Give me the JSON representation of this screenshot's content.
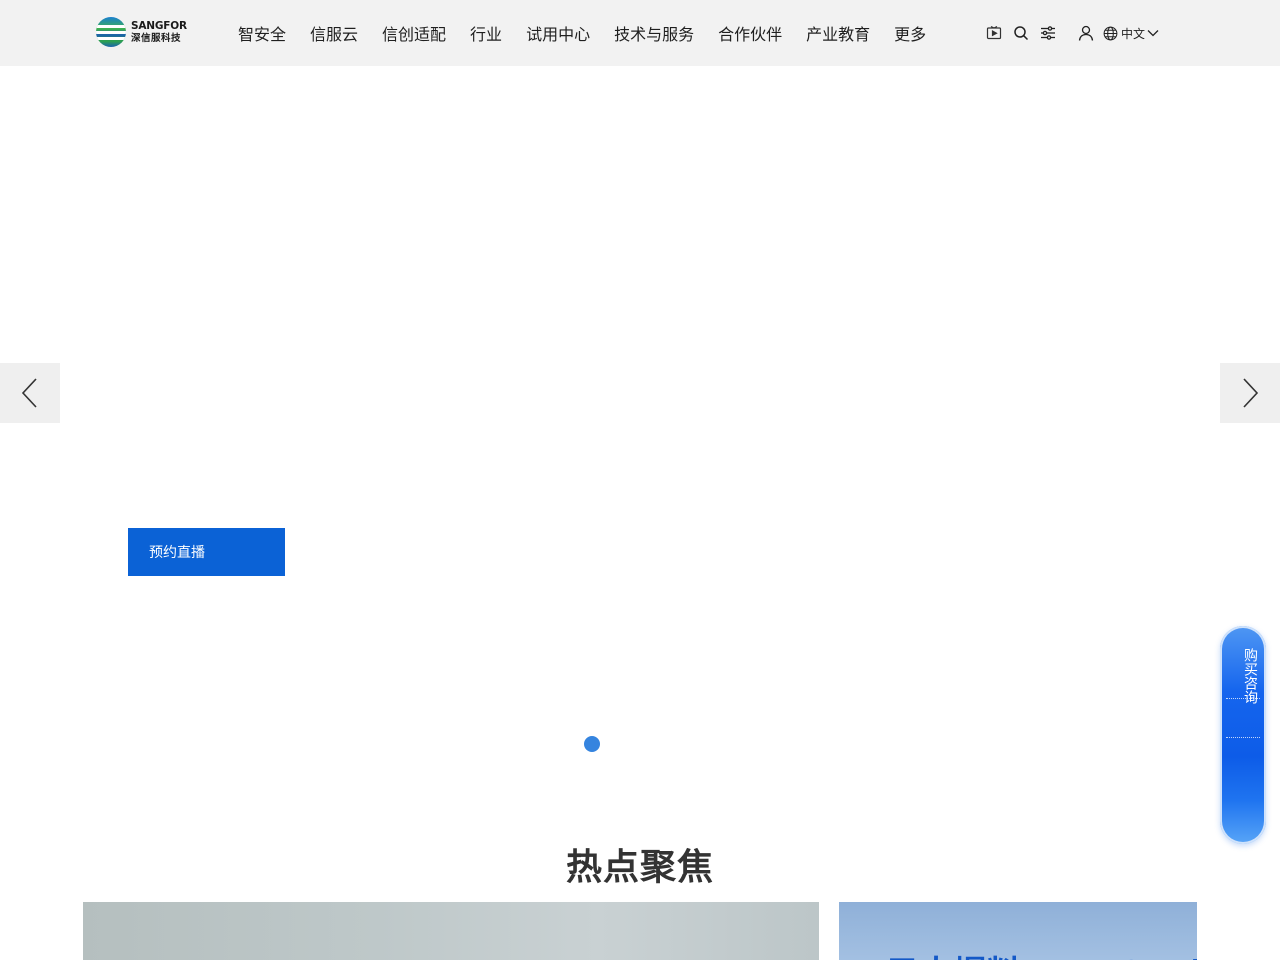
{
  "brand": {
    "logo_en": "SANGFOR",
    "logo_cn": "深信服科技",
    "logo_color_blue": "#1a7fd0",
    "logo_color_green": "#3fb24b"
  },
  "nav": {
    "items": [
      {
        "label": "智安全"
      },
      {
        "label": "信服云"
      },
      {
        "label": "信创适配"
      },
      {
        "label": "行业"
      },
      {
        "label": "试用中心"
      },
      {
        "label": "技术与服务"
      },
      {
        "label": "合作伙伴"
      },
      {
        "label": "产业教育"
      },
      {
        "label": "更多"
      }
    ]
  },
  "tools": {
    "icons": [
      "video-play-icon",
      "search-icon",
      "settings-sliders-icon",
      "user-icon",
      "globe-icon",
      "chevron-down-icon"
    ],
    "language_label": "中文"
  },
  "hero": {
    "cta_label": "预约直播",
    "cta_color": "#0b62d6",
    "active_slide": 1,
    "slide_count": 1,
    "dot_color": "#3584df"
  },
  "side_widget": {
    "label": "购买咨询",
    "accent_color": "#1565ee"
  },
  "hot_focus": {
    "title": "热点聚焦",
    "right_card_text": "云大爆料DeepSeek"
  }
}
